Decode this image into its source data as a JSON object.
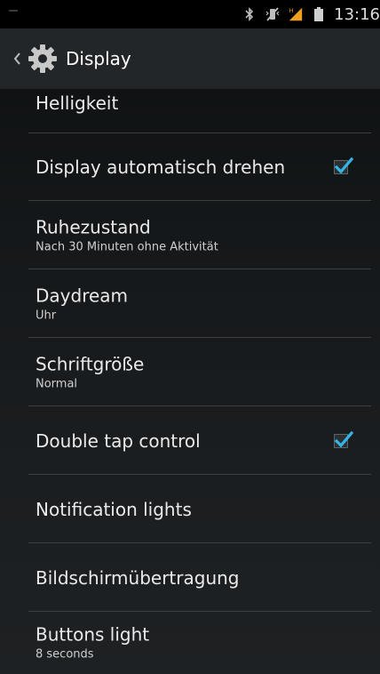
{
  "status_bar": {
    "time": "13:16",
    "icons": [
      "bluetooth-icon",
      "vibrate-mute-icon",
      "signal-icon",
      "battery-icon"
    ]
  },
  "action_bar": {
    "title": "Display",
    "icon": "gear-icon"
  },
  "settings": [
    {
      "title": "Helligkeit",
      "subtitle": ""
    },
    {
      "title": "Display automatisch drehen",
      "subtitle": "",
      "checked": true
    },
    {
      "title": "Ruhezustand",
      "subtitle": "Nach 30 Minuten ohne Aktivität"
    },
    {
      "title": "Daydream",
      "subtitle": "Uhr"
    },
    {
      "title": "Schriftgröße",
      "subtitle": "Normal"
    },
    {
      "title": "Double tap control",
      "subtitle": "",
      "checked": true
    },
    {
      "title": "Notification lights",
      "subtitle": ""
    },
    {
      "title": "Bildschirmübertragung",
      "subtitle": ""
    },
    {
      "title": "Buttons light",
      "subtitle": "8 seconds"
    }
  ],
  "colors": {
    "accent": "#33b5e5",
    "status_bar_bg": "#000000",
    "action_bar_bg": "#222628",
    "signal_orange": "#f0a020"
  }
}
